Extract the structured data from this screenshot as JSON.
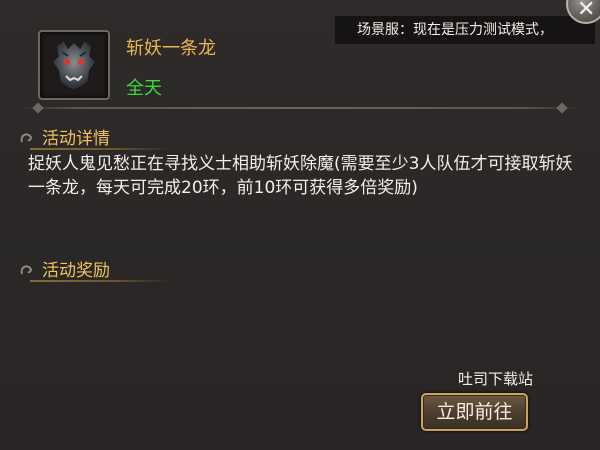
{
  "banner": {
    "text": "场景服：现在是压力测试模式，"
  },
  "mission": {
    "title": "斩妖一条龙",
    "time": "全天",
    "portrait_icon": "dragon-head-icon"
  },
  "details": {
    "header": "活动详情",
    "description": "捉妖人鬼见愁正在寻找义士相助斩妖除魔(需要至少3人队伍才可接取斩妖一条龙，每天可完成20环，前10环可获得多倍奖励)"
  },
  "rewards": {
    "header": "活动奖励"
  },
  "watermark": "吐司下载站",
  "actions": {
    "go_label": "立即前往",
    "close_icon": "close-icon"
  },
  "colors": {
    "title": "#e9b84e",
    "time": "#3fd93a",
    "section_header": "#f1c35e",
    "body_text": "#f2eee8",
    "button_border": "#c9a35e"
  }
}
